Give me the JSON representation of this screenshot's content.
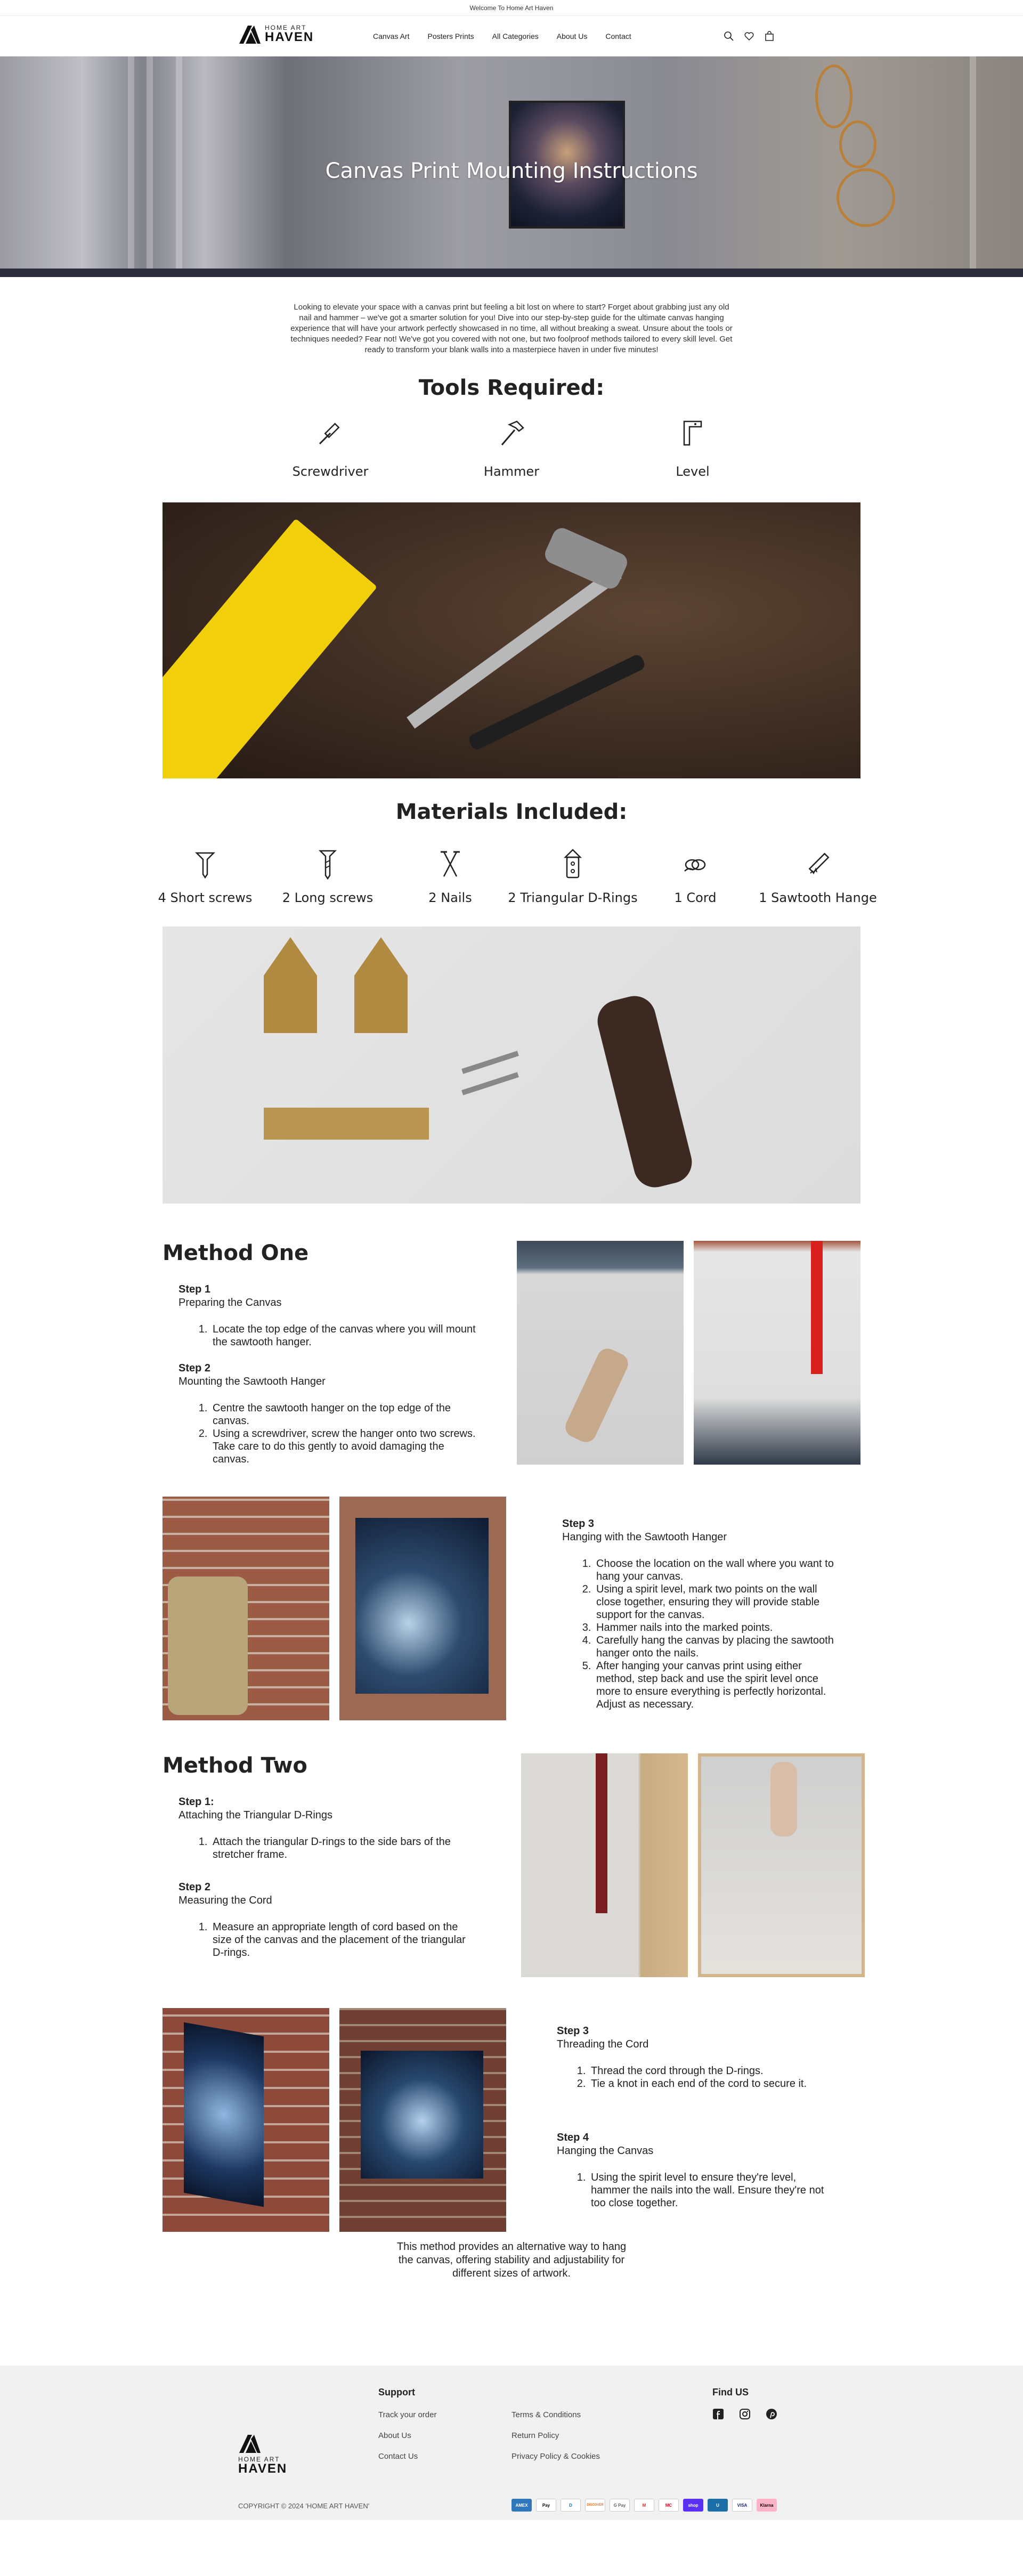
{
  "announcement": "Welcome To Home Art Haven",
  "brand": {
    "small": "HOME ART",
    "big": "HAVEN"
  },
  "nav": [
    "Canvas Art",
    "Posters Prints",
    "All Categories",
    "About Us",
    "Contact"
  ],
  "nav_icons": [
    "search-icon",
    "heart-icon",
    "cart-icon"
  ],
  "hero_title": "Canvas Print Mounting Instructions",
  "intro": "Looking to elevate your space with a canvas print but feeling a bit lost on where to start? Forget about grabbing just any old nail and hammer – we've got a smarter solution for you! Dive into our step-by-step guide for the ultimate canvas hanging experience that will have your artwork perfectly showcased in no time, all without breaking a sweat. Unsure about the tools or techniques needed? Fear not! We've got you covered with not one, but two foolproof methods tailored to every skill level. Get ready to transform your blank walls into a masterpiece haven in under five minutes!",
  "tools_title": "Tools Required:",
  "tools": [
    {
      "label": "Screwdriver",
      "icon": "screwdriver-icon"
    },
    {
      "label": "Hammer",
      "icon": "hammer-icon"
    },
    {
      "label": "Level",
      "icon": "level-icon"
    }
  ],
  "materials_title": "Materials Included:",
  "materials": [
    {
      "label": "4 Short screws",
      "icon": "short-screw-icon"
    },
    {
      "label": "2 Long screws",
      "icon": "long-screw-icon"
    },
    {
      "label": "2 Nails",
      "icon": "nails-icon"
    },
    {
      "label": "2 Triangular D-Rings",
      "icon": "d-ring-icon"
    },
    {
      "label": "1 Cord",
      "icon": "cord-icon"
    },
    {
      "label": "1 Sawtooth Hange",
      "icon": "sawtooth-hanger-icon"
    }
  ],
  "method_one": {
    "title": "Method One",
    "step1": {
      "title": "Step 1",
      "sub": "Preparing the Canvas",
      "items": [
        "Locate the top edge of the canvas where you will mount the sawtooth hanger."
      ]
    },
    "step2": {
      "title": "Step 2",
      "sub": "Mounting the Sawtooth Hanger",
      "items": [
        "Centre the sawtooth hanger on the top edge of the canvas.",
        "Using a screwdriver, screw the hanger onto two screws. Take care to do this gently to avoid damaging the canvas."
      ]
    },
    "step3": {
      "title": "Step 3",
      "sub": "Hanging with the Sawtooth Hanger",
      "items": [
        "Choose the location on the wall where you want to hang your canvas.",
        "Using a spirit level, mark two points on the wall close together, ensuring they will provide stable support for the canvas.",
        "Hammer nails into the marked points.",
        "Carefully hang the canvas by placing the sawtooth hanger onto the nails.",
        "After hanging your canvas print using either method, step back and use the spirit level once more to ensure everything is perfectly horizontal. Adjust as necessary."
      ]
    }
  },
  "method_two": {
    "title": "Method Two",
    "step1": {
      "title": "Step 1:",
      "sub": "Attaching the Triangular D-Rings",
      "items": [
        "Attach the triangular D-rings to the side bars of the stretcher frame."
      ]
    },
    "step2": {
      "title": "Step 2",
      "sub": "Measuring the Cord",
      "items": [
        "Measure an appropriate length of cord based on the size of the canvas and the placement of the triangular D-rings."
      ]
    },
    "step3": {
      "title": "Step 3",
      "sub": "Threading the Cord",
      "items": [
        "Thread the cord through the D-rings.",
        "Tie a knot in each end of the cord to secure it."
      ]
    },
    "step4": {
      "title": "Step 4",
      "sub": "Hanging the Canvas",
      "items": [
        "Using the spirit level to ensure they're level, hammer the nails into the wall. Ensure they're not too close together."
      ]
    },
    "closing": "This method provides an alternative way to hang the canvas, offering stability and adjustability for different sizes of artwork."
  },
  "footer": {
    "support_title": "Support",
    "col1": [
      "Track your order",
      "About Us",
      "Contact Us"
    ],
    "col2": [
      "Terms & Conditions",
      "Return Policy",
      "Privacy Policy & Cookies"
    ],
    "find_title": "Find US",
    "social": [
      "facebook-icon",
      "instagram-icon",
      "pinterest-icon"
    ],
    "copyright": "COPYRIGHT © 2024 'HOME ART HAVEN'",
    "payments": [
      {
        "name": "AMEX",
        "color": "#2e77bc"
      },
      {
        "name": "Pay",
        "color": "#ffffff"
      },
      {
        "name": "D",
        "color": "#ffffff"
      },
      {
        "name": "DISCOVER",
        "color": "#ffffff"
      },
      {
        "name": "G Pay",
        "color": "#ffffff"
      },
      {
        "name": "M",
        "color": "#ffffff"
      },
      {
        "name": "MC",
        "color": "#ffffff"
      },
      {
        "name": "shop",
        "color": "#5a31f4"
      },
      {
        "name": "U",
        "color": "#ffffff"
      },
      {
        "name": "VISA",
        "color": "#ffffff"
      },
      {
        "name": "Klarna",
        "color": "#ffb3c7"
      }
    ]
  }
}
